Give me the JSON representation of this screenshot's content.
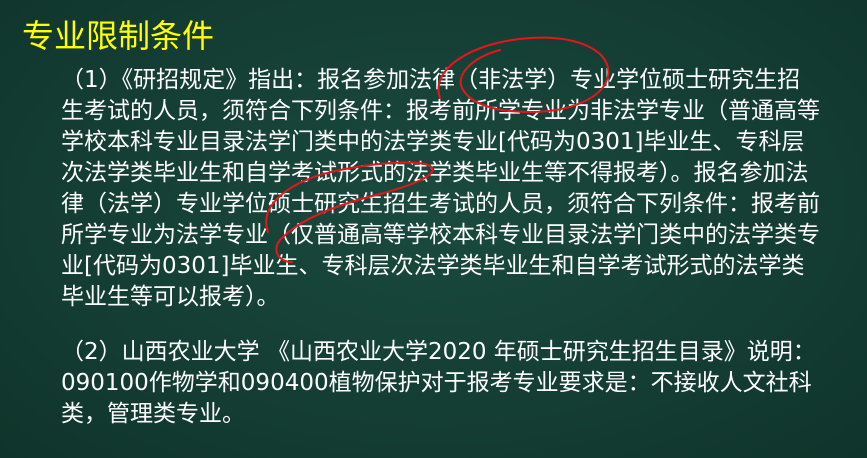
{
  "slide": {
    "title": "专业限制条件",
    "paragraphs": [
      "（1）《研招规定》指出：报名参加法律（非法学）专业学位硕士研究生招生考试的人员，须符合下列条件：报考前所学专业为非法学专业（普通高等学校本科专业目录法学门类中的法学类专业[代码为0301]毕业生、专科层次法学类毕业生和自学考试形式的法学类毕业生等不得报考）。报名参加法律（法学）专业学位硕士研究生招生考试的人员，须符合下列条件：报考前所学专业为法学专业（仅普通高等学校本科专业目录法学门类中的法学类专业[代码为0301]毕业生、专科层次法学类毕业生和自学考试形式的法学类毕业生等可以报考）。",
      "（2）山西农业大学 《山西农业大学2020 年硕士研究生招生目录》说明：090100作物学和090400植物保护对于报考专业要求是：不接收人文社科类，管理类专业。"
    ]
  },
  "colors": {
    "background": "#143d33",
    "title": "#ffff00",
    "body_text": "#ffffff",
    "annotation": "#e8141c"
  }
}
